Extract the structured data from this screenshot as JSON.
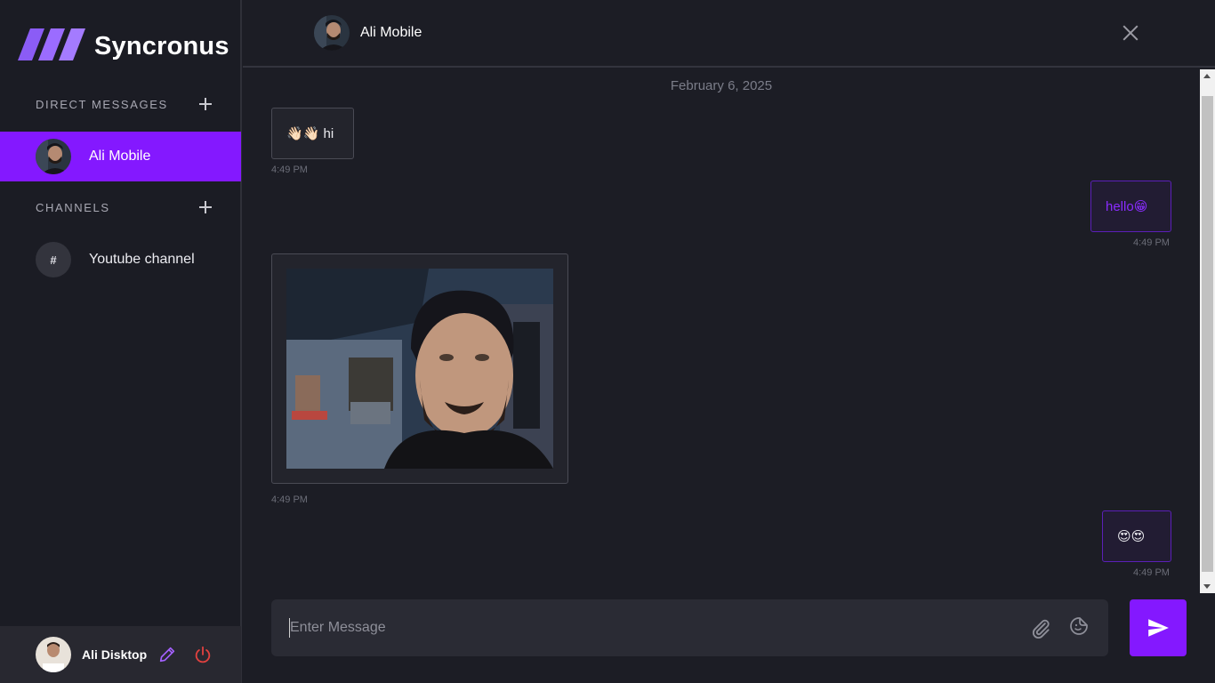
{
  "app": {
    "name": "Syncronus",
    "logo_icon": "triple-slash-logo",
    "accent_color": "#8418ff"
  },
  "sidebar": {
    "direct_messages": {
      "title": "DIRECT MESSAGES",
      "add_icon": "plus-icon",
      "items": [
        {
          "label": "Ali Mobile",
          "avatar": "avatar-photo",
          "active": true
        }
      ]
    },
    "channels": {
      "title": "CHANNELS",
      "add_icon": "plus-icon",
      "items": [
        {
          "label": "Youtube channel",
          "icon_text": "#"
        }
      ]
    },
    "user": {
      "name": "Ali Disktop",
      "edit_icon": "pencil-icon",
      "logout_icon": "power-icon"
    }
  },
  "chat": {
    "header": {
      "title": "Ali Mobile",
      "close_icon": "close-icon"
    },
    "date_separator": "February 6, 2025",
    "messages": [
      {
        "direction": "in",
        "type": "text",
        "text": "👋🏻👋🏻 hi",
        "time": "4:49 PM"
      },
      {
        "direction": "out",
        "type": "text",
        "text": "hello😁",
        "time": "4:49 PM"
      },
      {
        "direction": "in",
        "type": "image",
        "image": "selfie-photo",
        "time": "4:49 PM"
      },
      {
        "direction": "out",
        "type": "text",
        "text": "😍😍",
        "time": "4:49 PM"
      }
    ],
    "composer": {
      "placeholder": "Enter Message",
      "value": "",
      "attach_icon": "paperclip-icon",
      "sticker_icon": "sticker-icon",
      "send_icon": "send-icon"
    }
  }
}
